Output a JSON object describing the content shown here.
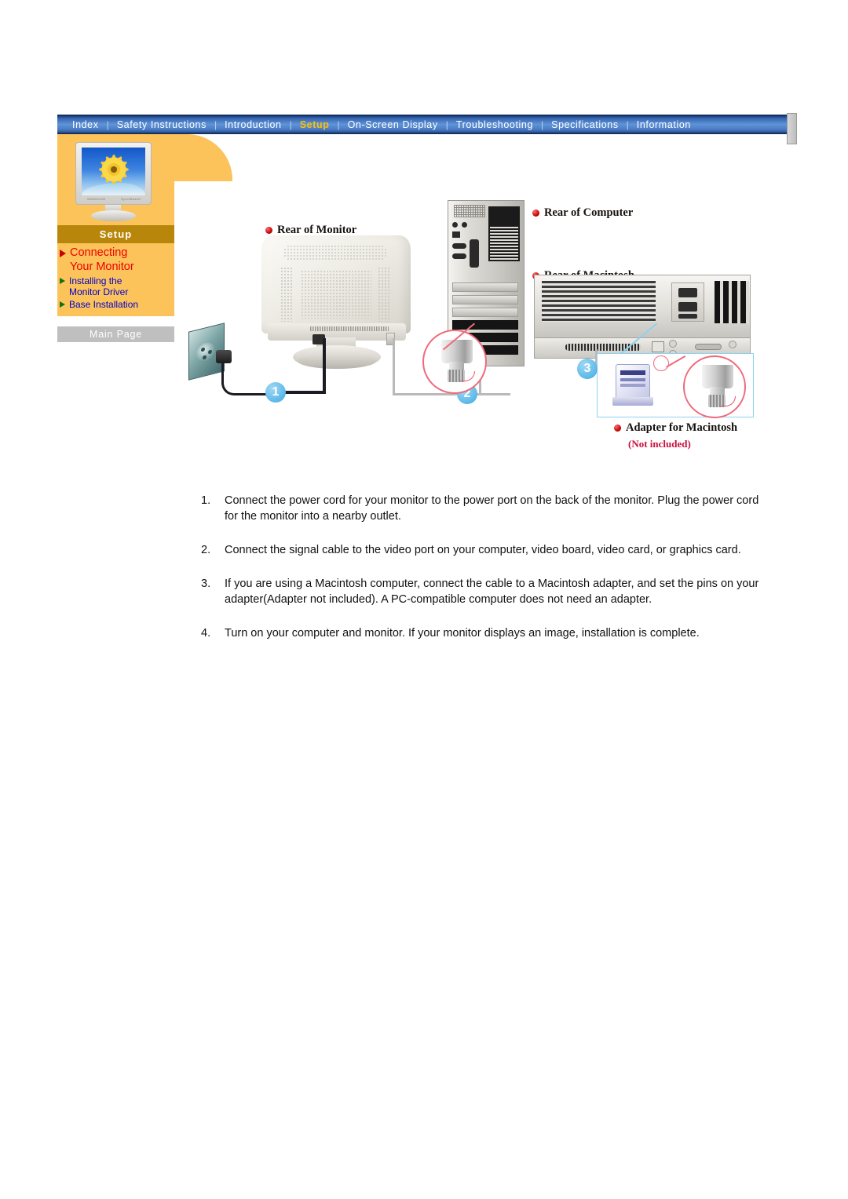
{
  "nav": {
    "items": [
      {
        "label": "Index",
        "active": false
      },
      {
        "label": "Safety Instructions",
        "active": false
      },
      {
        "label": "Introduction",
        "active": false
      },
      {
        "label": "Setup",
        "active": true
      },
      {
        "label": "On-Screen Display",
        "active": false
      },
      {
        "label": "Troubleshooting",
        "active": false
      },
      {
        "label": "Specifications",
        "active": false
      },
      {
        "label": "Information",
        "active": false
      }
    ],
    "separator": "|",
    "accent_color": "#ffc000",
    "bar_color": "#3766b0"
  },
  "sidebar": {
    "section_title": "Setup",
    "band_color": "#b8860b",
    "panel_color": "#fcc35a",
    "thumbnail_brand_left": "SAMSUNG",
    "thumbnail_brand_right": "SyncMaster",
    "links": [
      {
        "label_line1": "Connecting",
        "label_line2": "Your Monitor",
        "active": true,
        "color": "#ee0000",
        "arrow_color": "#c80000"
      },
      {
        "label_line1": "Installing the",
        "label_line2": "Monitor Driver",
        "active": false,
        "color": "#0000cc",
        "arrow_color": "#127012"
      },
      {
        "label_line1": "Base Installation",
        "label_line2": "",
        "active": false,
        "color": "#0000cc",
        "arrow_color": "#127012"
      }
    ],
    "main_page_button": "Main Page"
  },
  "diagram": {
    "labels": {
      "rear_of_monitor": "Rear of Monitor",
      "rear_of_computer": "Rear of Computer",
      "rear_of_macintosh": "Rear of  Macintosh",
      "adapter_for_macintosh": "Adapter for Macintosh",
      "not_included": "(Not included)"
    },
    "callouts": [
      {
        "number": "1"
      },
      {
        "number": "2"
      },
      {
        "number": "3"
      }
    ],
    "callout_color": "#5cb8e8",
    "bullet_color": "#c10000"
  },
  "instructions": [
    {
      "number": "1.",
      "text": "Connect the power cord for your monitor to the power port on the back of the monitor. Plug the power cord for the monitor into a nearby outlet."
    },
    {
      "number": "2.",
      "text": "Connect the signal cable to the video port on your computer, video board, video card, or graphics card."
    },
    {
      "number": "3.",
      "text": "If you are using a Macintosh computer, connect the cable to a Macintosh adapter, and set the pins on your adapter(Adapter not included). A PC-compatible computer does not need an adapter."
    },
    {
      "number": "4.",
      "text": "Turn on your computer and monitor. If your monitor displays an image, installation is complete."
    }
  ]
}
